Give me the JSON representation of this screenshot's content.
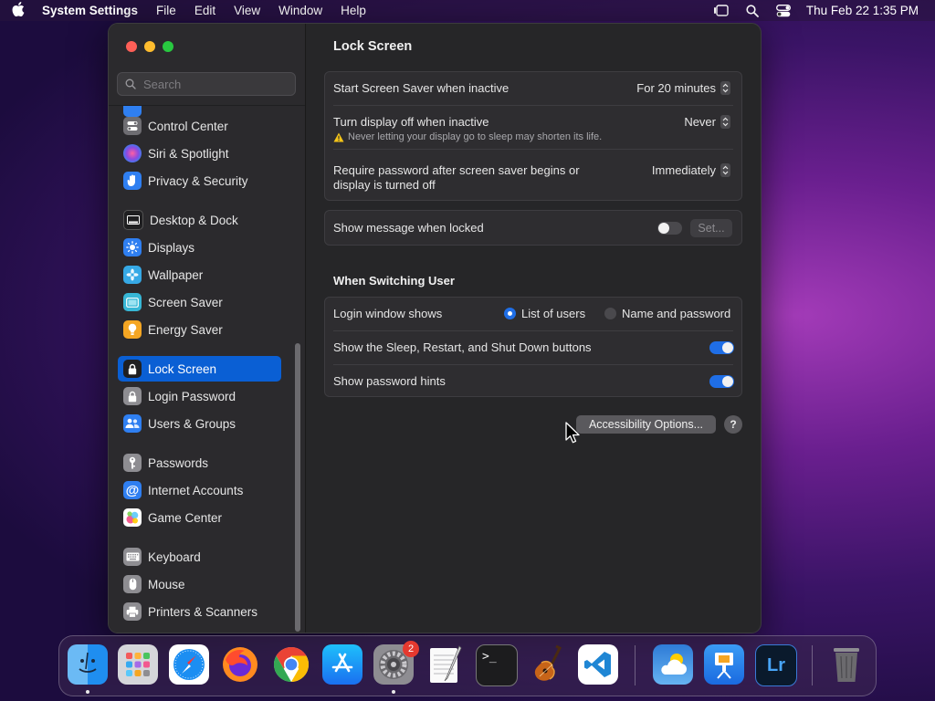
{
  "menubar": {
    "app_name": "System Settings",
    "menus": [
      "File",
      "Edit",
      "View",
      "Window",
      "Help"
    ],
    "datetime": "Thu Feb 22  1:35 PM"
  },
  "window": {
    "search": {
      "placeholder": "Search"
    },
    "sidebar": {
      "items": [
        {
          "label": "Control Center",
          "icon": "control-center-icon",
          "color": "#6e6d72"
        },
        {
          "label": "Siri & Spotlight",
          "icon": "siri-icon",
          "color": "#b44ad0"
        },
        {
          "label": "Privacy & Security",
          "icon": "hand-icon",
          "color": "#2f7ff1"
        },
        {
          "label": "Desktop & Dock",
          "icon": "dock-icon",
          "color": "#1f1f21"
        },
        {
          "label": "Displays",
          "icon": "sun-icon",
          "color": "#2f7ff1"
        },
        {
          "label": "Wallpaper",
          "icon": "flower-icon",
          "color": "#36a9e6"
        },
        {
          "label": "Screen Saver",
          "icon": "screen-saver-icon",
          "color": "#37b7d6"
        },
        {
          "label": "Energy Saver",
          "icon": "lightbulb-icon",
          "color": "#f5a623"
        },
        {
          "label": "Lock Screen",
          "icon": "lock-icon",
          "color": "#1f1f21",
          "active": true
        },
        {
          "label": "Login Password",
          "icon": "lock-icon",
          "color": "#8e8d92"
        },
        {
          "label": "Users & Groups",
          "icon": "users-icon",
          "color": "#2f7ff1"
        },
        {
          "label": "Passwords",
          "icon": "key-icon",
          "color": "#8e8d92"
        },
        {
          "label": "Internet Accounts",
          "icon": "at-icon",
          "color": "#2f7ff1"
        },
        {
          "label": "Game Center",
          "icon": "game-center-icon",
          "color": "#ffffff"
        },
        {
          "label": "Keyboard",
          "icon": "keyboard-icon",
          "color": "#8e8d92"
        },
        {
          "label": "Mouse",
          "icon": "mouse-icon",
          "color": "#8e8d92"
        },
        {
          "label": "Printers & Scanners",
          "icon": "printer-icon",
          "color": "#8e8d92"
        }
      ]
    },
    "main": {
      "title": "Lock Screen",
      "screen_saver": {
        "label": "Start Screen Saver when inactive",
        "value": "For 20 minutes"
      },
      "display_off": {
        "label": "Turn display off when inactive",
        "value": "Never",
        "warning": "Never letting your display go to sleep may shorten its life."
      },
      "require_password": {
        "label_line1": "Require password after screen saver begins or",
        "label_line2": "display is turned off",
        "value": "Immediately"
      },
      "show_message": {
        "label": "Show message when locked",
        "enabled": false,
        "set_button": "Set..."
      },
      "switching_user": {
        "title": "When Switching User",
        "login_window": {
          "label": "Login window shows",
          "options": [
            "List of users",
            "Name and password"
          ],
          "selected": "List of users"
        },
        "sleep_buttons": {
          "label": "Show the Sleep, Restart, and Shut Down buttons",
          "enabled": true
        },
        "password_hints": {
          "label": "Show password hints",
          "enabled": true
        }
      },
      "accessibility_button": "Accessibility Options...",
      "help_button": "?"
    }
  },
  "dock": {
    "apps": [
      {
        "name": "Finder",
        "icon": "finder-icon",
        "running": true
      },
      {
        "name": "Launchpad",
        "icon": "launchpad-icon"
      },
      {
        "name": "Safari",
        "icon": "safari-icon"
      },
      {
        "name": "Firefox",
        "icon": "firefox-icon"
      },
      {
        "name": "Chrome",
        "icon": "chrome-icon"
      },
      {
        "name": "App Store",
        "icon": "app-store-icon"
      },
      {
        "name": "System Settings",
        "icon": "system-settings-icon",
        "badge": "2",
        "running": true
      },
      {
        "name": "TextEdit",
        "icon": "textedit-icon"
      },
      {
        "name": "Terminal",
        "icon": "terminal-icon"
      },
      {
        "name": "GarageBand",
        "icon": "garageband-icon"
      },
      {
        "name": "VS Code",
        "icon": "vscode-icon"
      },
      {
        "name": "Weather",
        "icon": "weather-icon"
      },
      {
        "name": "Keynote",
        "icon": "keynote-icon"
      },
      {
        "name": "Lightroom",
        "icon": "lightroom-icon",
        "text": "Lr"
      },
      {
        "name": "Trash",
        "icon": "trash-icon"
      }
    ]
  }
}
